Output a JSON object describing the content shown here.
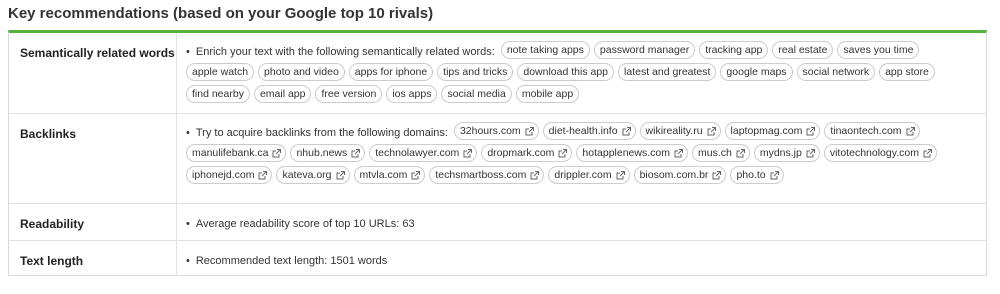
{
  "header": {
    "title": "Key recommendations (based on your Google top 10 rivals)"
  },
  "colors": {
    "accent": "#54b23f",
    "border": "#dadada"
  },
  "rows": {
    "semantic": {
      "label": "Semantically related  words",
      "intro": "Enrich your text with the following semantically related words:",
      "chips": [
        "note taking apps",
        "password manager",
        "tracking app",
        "real estate",
        "saves you time",
        "apple watch",
        "photo and video",
        "apps for iphone",
        "tips and tricks",
        "download this app",
        "latest and greatest",
        "google maps",
        "social network",
        "app store",
        "find nearby",
        "email app",
        "free version",
        "ios apps",
        "social media",
        "mobile app"
      ]
    },
    "backlinks": {
      "label": "Backlinks",
      "intro": "Try to acquire backlinks from the following domains:",
      "chips": [
        "32hours.com",
        "diet-health.info",
        "wikireality.ru",
        "laptopmag.com",
        "tinaontech.com",
        "manulifebank.ca",
        "nhub.news",
        "technolawyer.com",
        "dropmark.com",
        "hotapplenews.com",
        "mus.ch",
        "mydns.jp",
        "vitotechnology.com",
        "iphonejd.com",
        "kateva.org",
        "mtvla.com",
        "techsmartboss.com",
        "drippler.com",
        "biosom.com.br",
        "pho.to"
      ],
      "icon": "external-link-icon"
    },
    "readability": {
      "label": "Readability",
      "text": "Average readability score of top 10 URLs:  63"
    },
    "textlength": {
      "label": "Text length",
      "text": "Recommended text length:  1501 words"
    }
  }
}
